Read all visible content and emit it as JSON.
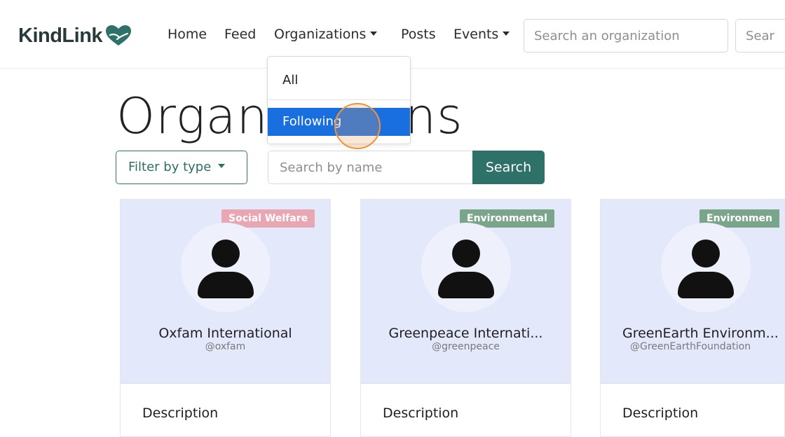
{
  "navbar": {
    "brand": "KindLink",
    "links": {
      "home": "Home",
      "feed": "Feed",
      "organizations": "Organizations",
      "posts": "Posts",
      "events": "Events"
    },
    "search_org_placeholder": "Search an organization",
    "search_second_placeholder": "Sear"
  },
  "organizations_dropdown": {
    "items": [
      "All",
      "Following"
    ],
    "highlighted": "Following"
  },
  "page": {
    "title": "Organizations",
    "filter_label": "Filter by type",
    "search_placeholder": "Search by name",
    "search_button": "Search"
  },
  "cards": [
    {
      "badge": "Social Welfare",
      "badge_color": "#e8a7b3",
      "name": "Oxfam International",
      "handle": "@oxfam",
      "description_label": "Description"
    },
    {
      "badge": "Environmental",
      "badge_color": "#7aa58a",
      "name": "Greenpeace Internati...",
      "handle": "@greenpeace",
      "description_label": "Description"
    },
    {
      "badge": "Environmen",
      "badge_color": "#7aa58a",
      "name": "GreenEarth Environm...",
      "handle": "@GreenEarthFoundation",
      "description_label": "Description"
    }
  ],
  "colors": {
    "accent": "#2e7169",
    "dropdown_highlight": "#1a6fe0",
    "card_header_bg": "#e4e8fb",
    "click_marker": "#f0943b"
  }
}
